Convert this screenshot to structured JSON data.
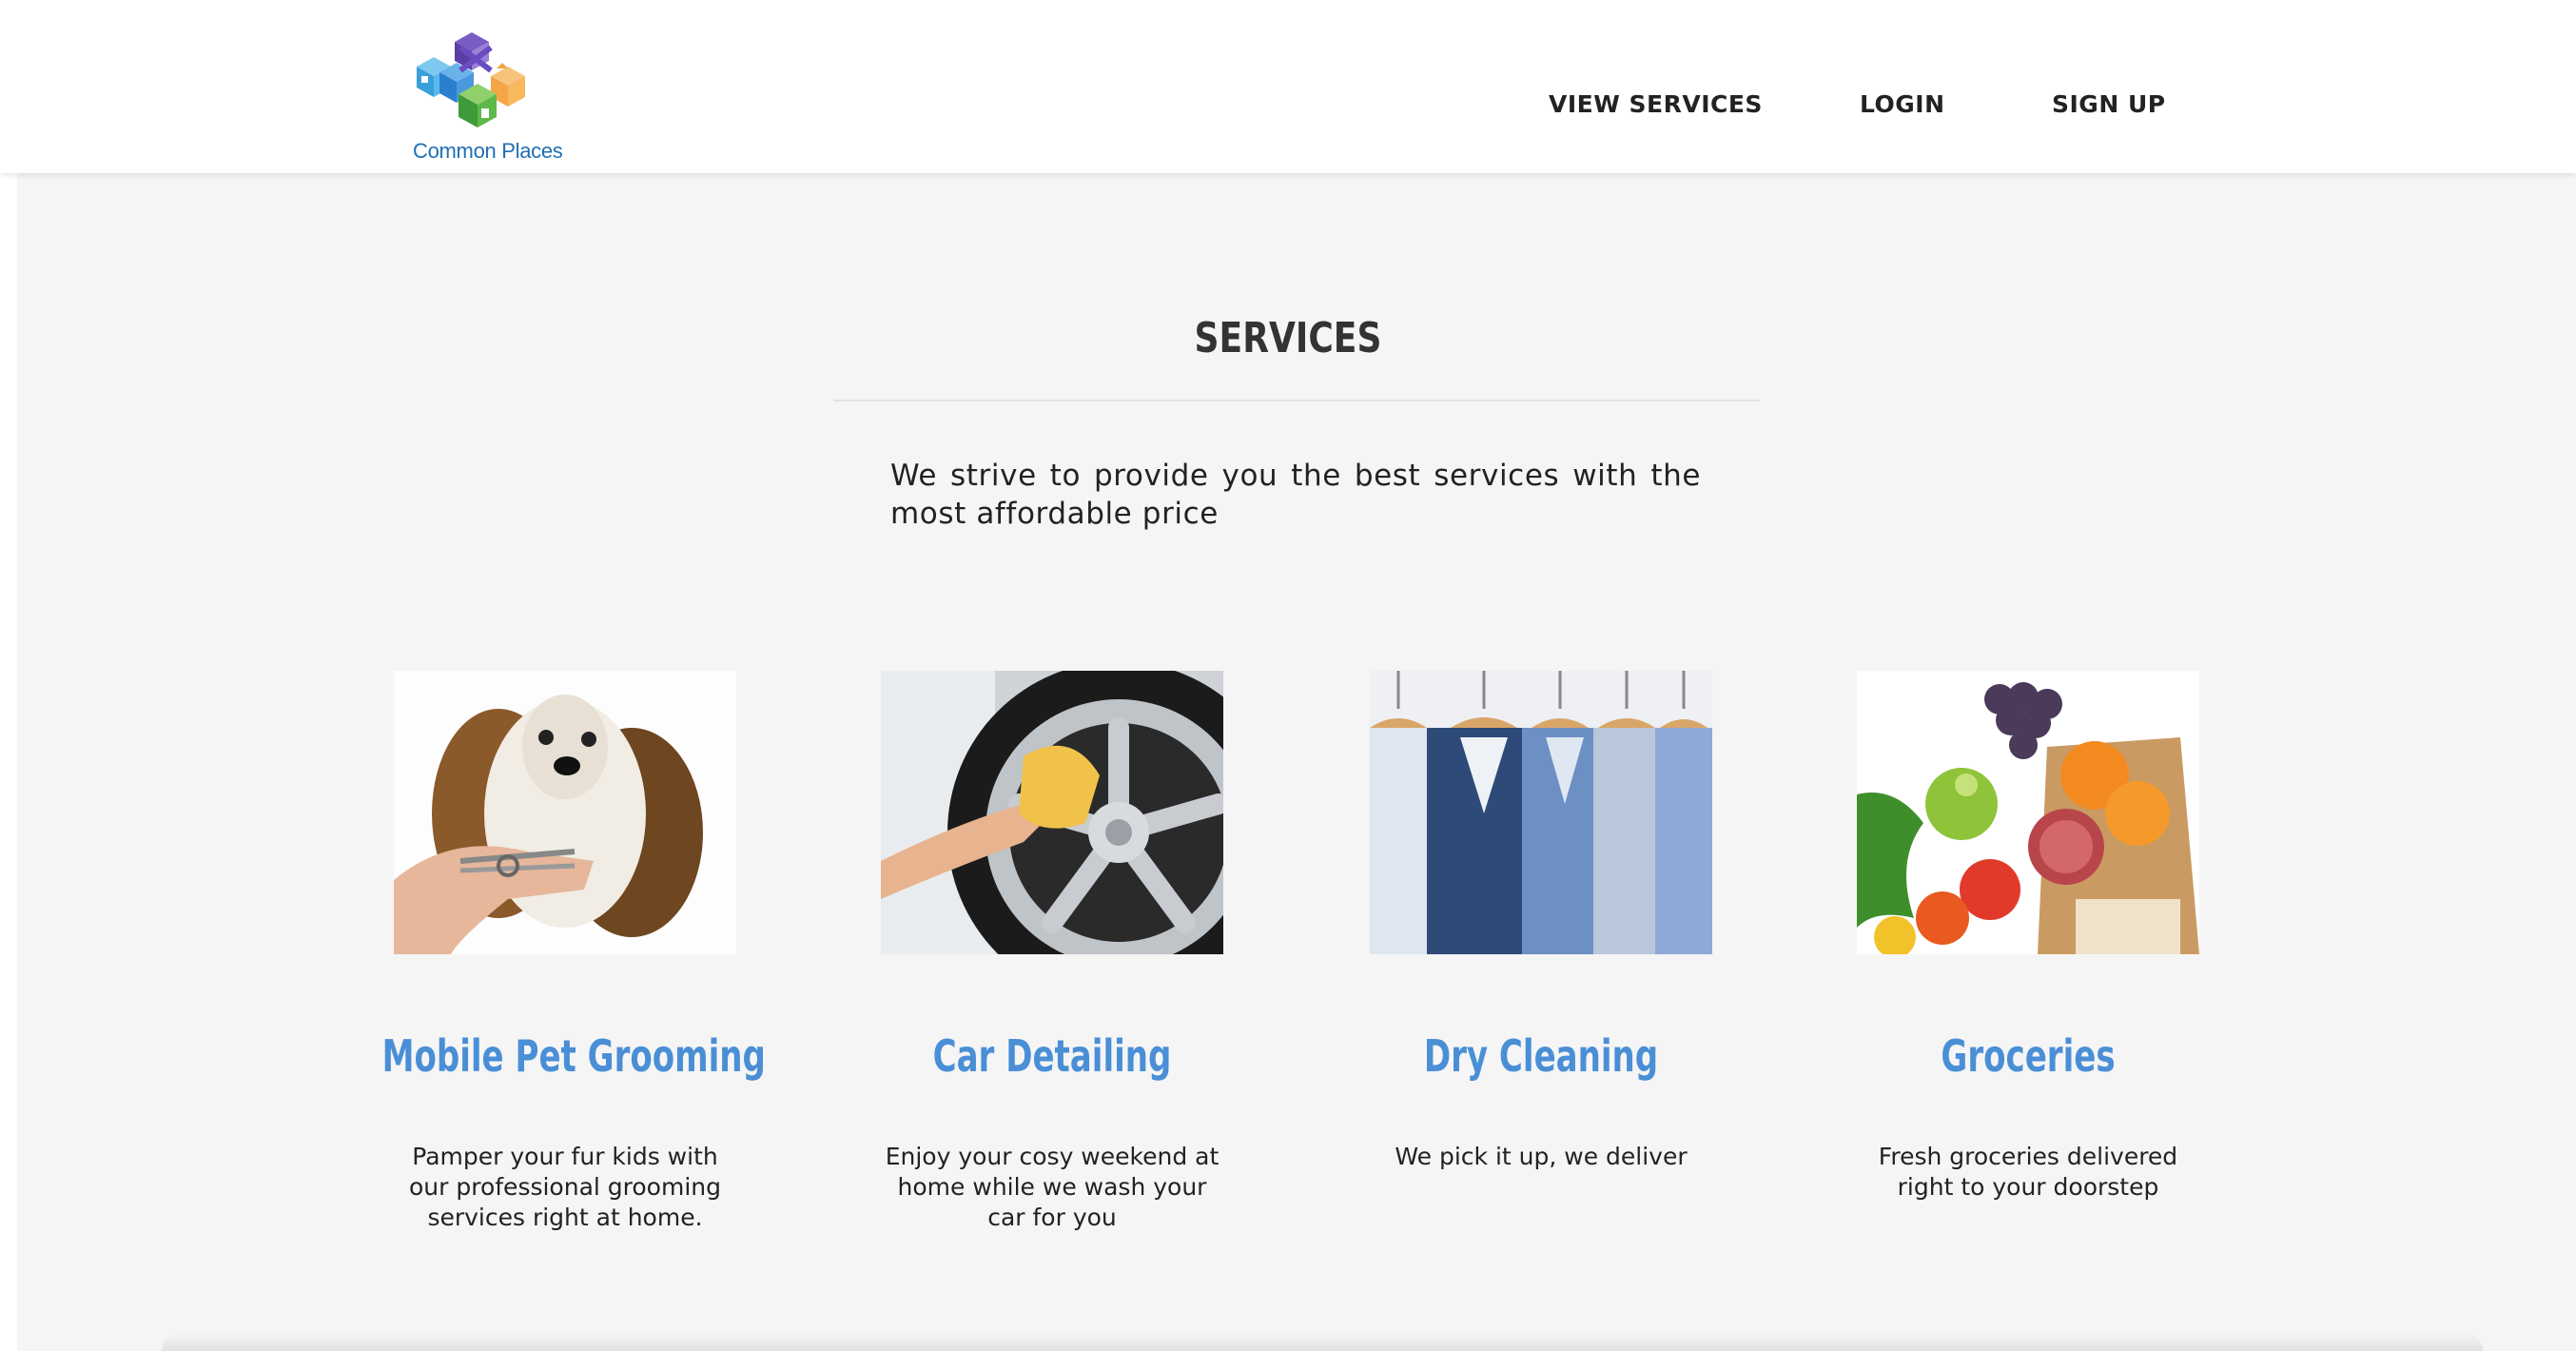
{
  "header": {
    "logo_text": "Common Places",
    "nav": [
      {
        "label": "VIEW SERVICES"
      },
      {
        "label": "LOGIN"
      },
      {
        "label": "SIGN UP"
      }
    ]
  },
  "section": {
    "title": "SERVICES",
    "intro": "We strive to provide you the best services with the most affordable price"
  },
  "services": [
    {
      "title": "Mobile Pet Grooming",
      "description": "Pamper your fur kids with our professional grooming services right at home.",
      "image": "dog-grooming-image"
    },
    {
      "title": "Car Detailing",
      "description": "Enjoy your cosy weekend at home while we wash your car for you",
      "image": "car-wheel-image"
    },
    {
      "title": "Dry Cleaning",
      "description": "We pick it up, we deliver",
      "image": "shirts-on-hangers-image"
    },
    {
      "title": "Groceries",
      "description": "Fresh groceries delivered right to your doorstep",
      "image": "groceries-bag-image"
    }
  ],
  "colors": {
    "accent": "#4a8fd6",
    "background": "#f5f5f5",
    "logo_blue": "#1f6fb4"
  }
}
